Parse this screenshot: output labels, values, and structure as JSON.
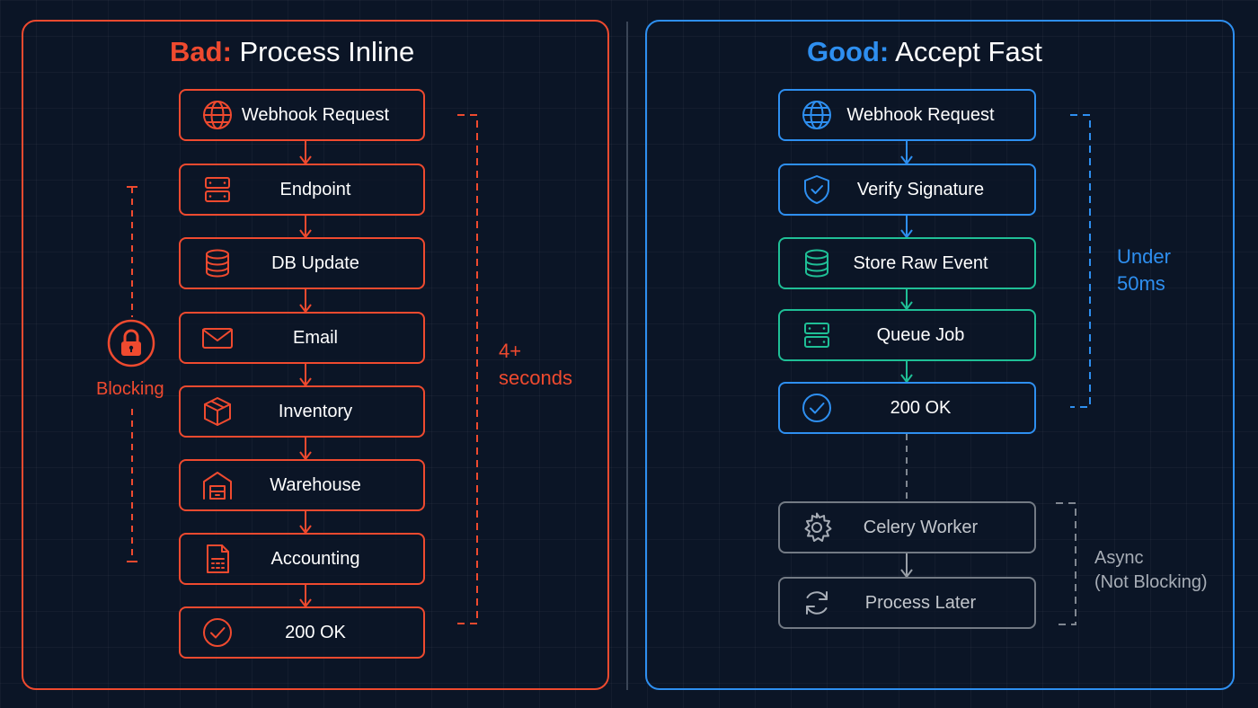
{
  "bad": {
    "title_accent": "Bad:",
    "title_rest": " Process Inline",
    "steps": [
      "Webhook Request",
      "Endpoint",
      "DB Update",
      "Email",
      "Inventory",
      "Warehouse",
      "Accounting",
      "200 OK"
    ],
    "duration_line1": "4+",
    "duration_line2": "seconds",
    "blocking_label": "Blocking",
    "color": "#ef4a2f"
  },
  "good": {
    "title_accent": "Good:",
    "title_rest": " Accept Fast",
    "steps": [
      "Webhook Request",
      "Verify Signature",
      "Store Raw Event",
      "Queue Job",
      "200 OK"
    ],
    "async_steps": [
      "Celery Worker",
      "Process Later"
    ],
    "duration_line1": "Under",
    "duration_line2": "50ms",
    "async_line1": "Async",
    "async_line2": "(Not Blocking)",
    "color": "#2e8ff0",
    "queue_color": "#1fbf96",
    "async_color": "#737a84"
  },
  "icons": {
    "bad": [
      "globe-icon",
      "server-icon",
      "database-icon",
      "mail-icon",
      "package-icon",
      "warehouse-icon",
      "calculator-icon",
      "check-circle-icon"
    ],
    "good": [
      "globe-icon",
      "shield-check-icon",
      "database-icon",
      "server-icon",
      "check-circle-icon"
    ],
    "async": [
      "gear-icon",
      "refresh-icon"
    ],
    "blocking": "lock-icon"
  }
}
